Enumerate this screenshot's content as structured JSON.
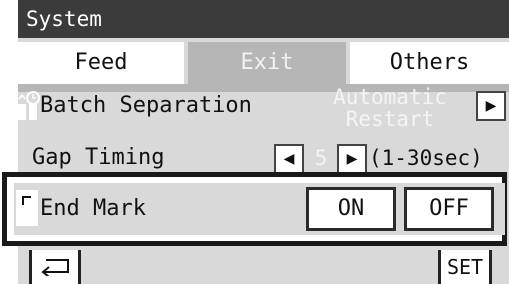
{
  "title": "System",
  "tabs": [
    {
      "label": "Feed",
      "active": false
    },
    {
      "label": "Exit",
      "active": true
    },
    {
      "label": "Others",
      "active": false
    }
  ],
  "batch_separation": {
    "label": "Batch Separation",
    "value_line1": "Automatic",
    "value_line2": "Restart",
    "next_icon": "right-arrow-icon"
  },
  "gap_timing": {
    "label": "Gap Timing",
    "value": "5",
    "range": "(1-30sec)",
    "prev_icon": "left-arrow-icon",
    "next_icon": "right-arrow-icon"
  },
  "end_mark": {
    "label": "End Mark",
    "on_label": "ON",
    "off_label": "OFF"
  },
  "footer": {
    "back_icon": "return-arrow-icon",
    "set_label": "SET"
  },
  "colors": {
    "title_bar": "#3b3b3b",
    "active_tab": "#b6b6b6",
    "panel": "#d9d9d9",
    "button": "#ffffff"
  }
}
